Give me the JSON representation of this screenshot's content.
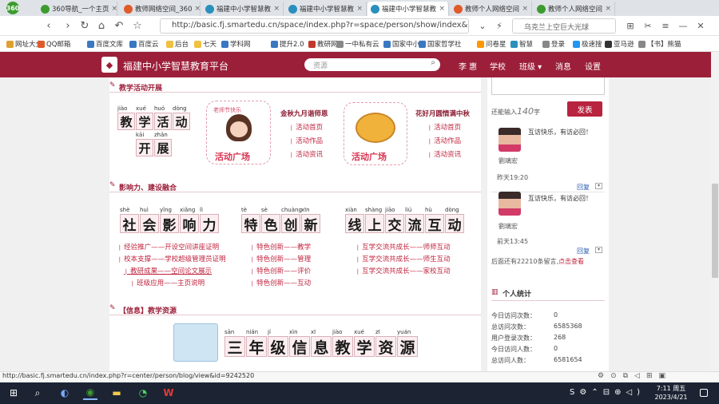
{
  "browser": {
    "logo": "360",
    "tabs": [
      {
        "label": "360导航_一个主页",
        "color": "#3c9c2e"
      },
      {
        "label": "教师网络空间_360",
        "color": "#e05a2a"
      },
      {
        "label": "福建中小学智慧教",
        "color": "#2a8fbd"
      },
      {
        "label": "福建中小学智慧教",
        "color": "#2a8fbd"
      },
      {
        "label": "福建中小学智慧教",
        "color": "#2a8fbd",
        "active": true
      },
      {
        "label": "教师个人网络空间",
        "color": "#e05a2a"
      },
      {
        "label": "教师个人网络空间",
        "color": "#3c9c2e"
      }
    ],
    "url": "http://basic.fj.smartedu.cn/space/index.php?r=space/person/show/index&sid=6",
    "search": "乌克兰上空巨大光球",
    "bookmarks": [
      "网址大全",
      "QQ邮箱",
      "百度文库",
      "百度云",
      "后台",
      "七天",
      "学科网",
      "提升2.0",
      "教研网",
      "一中私有云",
      "国家中小学",
      "国家哲学社",
      "问卷星",
      "智慧",
      "登录",
      "极速搜",
      "亚马逊",
      "【书】熊猫"
    ],
    "status_url": "http://basic.fj.smartedu.cn/index.php?r=center/person/blog/view&id=9242520"
  },
  "site": {
    "title": "福建中小学智慧教育平台",
    "search_placeholder": "资源",
    "nav": [
      "李 惠",
      "学校",
      "班级 ▾",
      "消息",
      "设置"
    ]
  },
  "sections": {
    "activity": {
      "header": "教学活动开展",
      "banner_pinyin": [
        "jiào",
        "xué",
        "huó",
        "dòng",
        "kāi",
        "zhǎn"
      ],
      "banner_chars": [
        "教",
        "学",
        "活",
        "动",
        "开",
        "展"
      ],
      "card1_caption": "活动广场",
      "card1_bubble": "老师节快乐",
      "card2_caption": "活动广场",
      "col1_title": "金秋九月谐师恩",
      "col1_links": [
        "活动首页",
        "活动作品",
        "活动资讯"
      ],
      "col2_title": "花好月圆情满中秋",
      "col2_links": [
        "活动首页",
        "活动作品",
        "活动资讯"
      ]
    },
    "influence": {
      "header": "影响力、建设融合",
      "b1_pinyin": [
        "shè",
        "huì",
        "yǐng",
        "xiǎng",
        "lì"
      ],
      "b1_chars": [
        "社",
        "会",
        "影",
        "响",
        "力"
      ],
      "b2_pinyin": [
        "tè",
        "sè",
        "chuàng",
        "xīn"
      ],
      "b2_chars": [
        "特",
        "色",
        "创",
        "新"
      ],
      "b3_pinyin": [
        "xiàn",
        "shàng",
        "jiāo",
        "liú",
        "hù",
        "dòng"
      ],
      "b3_chars": [
        "线",
        "上",
        "交",
        "流",
        "互",
        "动"
      ],
      "col1_links": [
        "经验推广——开设空间讲座证明",
        "校本支撑——学校超级管理员证明",
        "教研成果——空间论文展示",
        "班级应用——主页说明"
      ],
      "col2_links": [
        "特色创新——教学",
        "特色创新——管理",
        "特色创新——评价",
        "特色创新——互动"
      ],
      "col3_links": [
        "互学交流共成长——师师互动",
        "互学交流共成长——师生互动",
        "互学交流共成长——家校互动"
      ]
    },
    "resource": {
      "header": "【信息】教学资源",
      "banner_pinyin": [
        "sān",
        "nián",
        "jí",
        "xìn",
        "xī",
        "jiào",
        "xué",
        "zī",
        "yuán"
      ],
      "banner_chars": [
        "三",
        "年",
        "级",
        "信",
        "息",
        "教",
        "学",
        "资",
        "源"
      ]
    }
  },
  "sidebar": {
    "remaining_prefix": "还能输入",
    "remaining_count": "140",
    "remaining_suffix": "字",
    "send_label": "发表",
    "comments": [
      {
        "text": "互访快乐，有访必回！",
        "name": "劉璃宏",
        "time": "昨天19:20",
        "reply": "回复"
      },
      {
        "text": "互访快乐，有访必回！",
        "name": "劉璃宏",
        "time": "前天13:45",
        "reply": "回复"
      }
    ],
    "more_text": "后面还有22210条留言,",
    "more_link": "点击查看",
    "stats_title": "个人统计",
    "stats": [
      {
        "label": "今日访问次数：",
        "value": "0"
      },
      {
        "label": "总访问次数：",
        "value": "6585368"
      },
      {
        "label": "用户登录次数：",
        "value": "268"
      },
      {
        "label": "今日访问人数：",
        "value": "0"
      },
      {
        "label": "总访问人数：",
        "value": "6581654"
      }
    ]
  },
  "taskbar": {
    "time": "7:11 周五",
    "date": "2023/4/21"
  }
}
